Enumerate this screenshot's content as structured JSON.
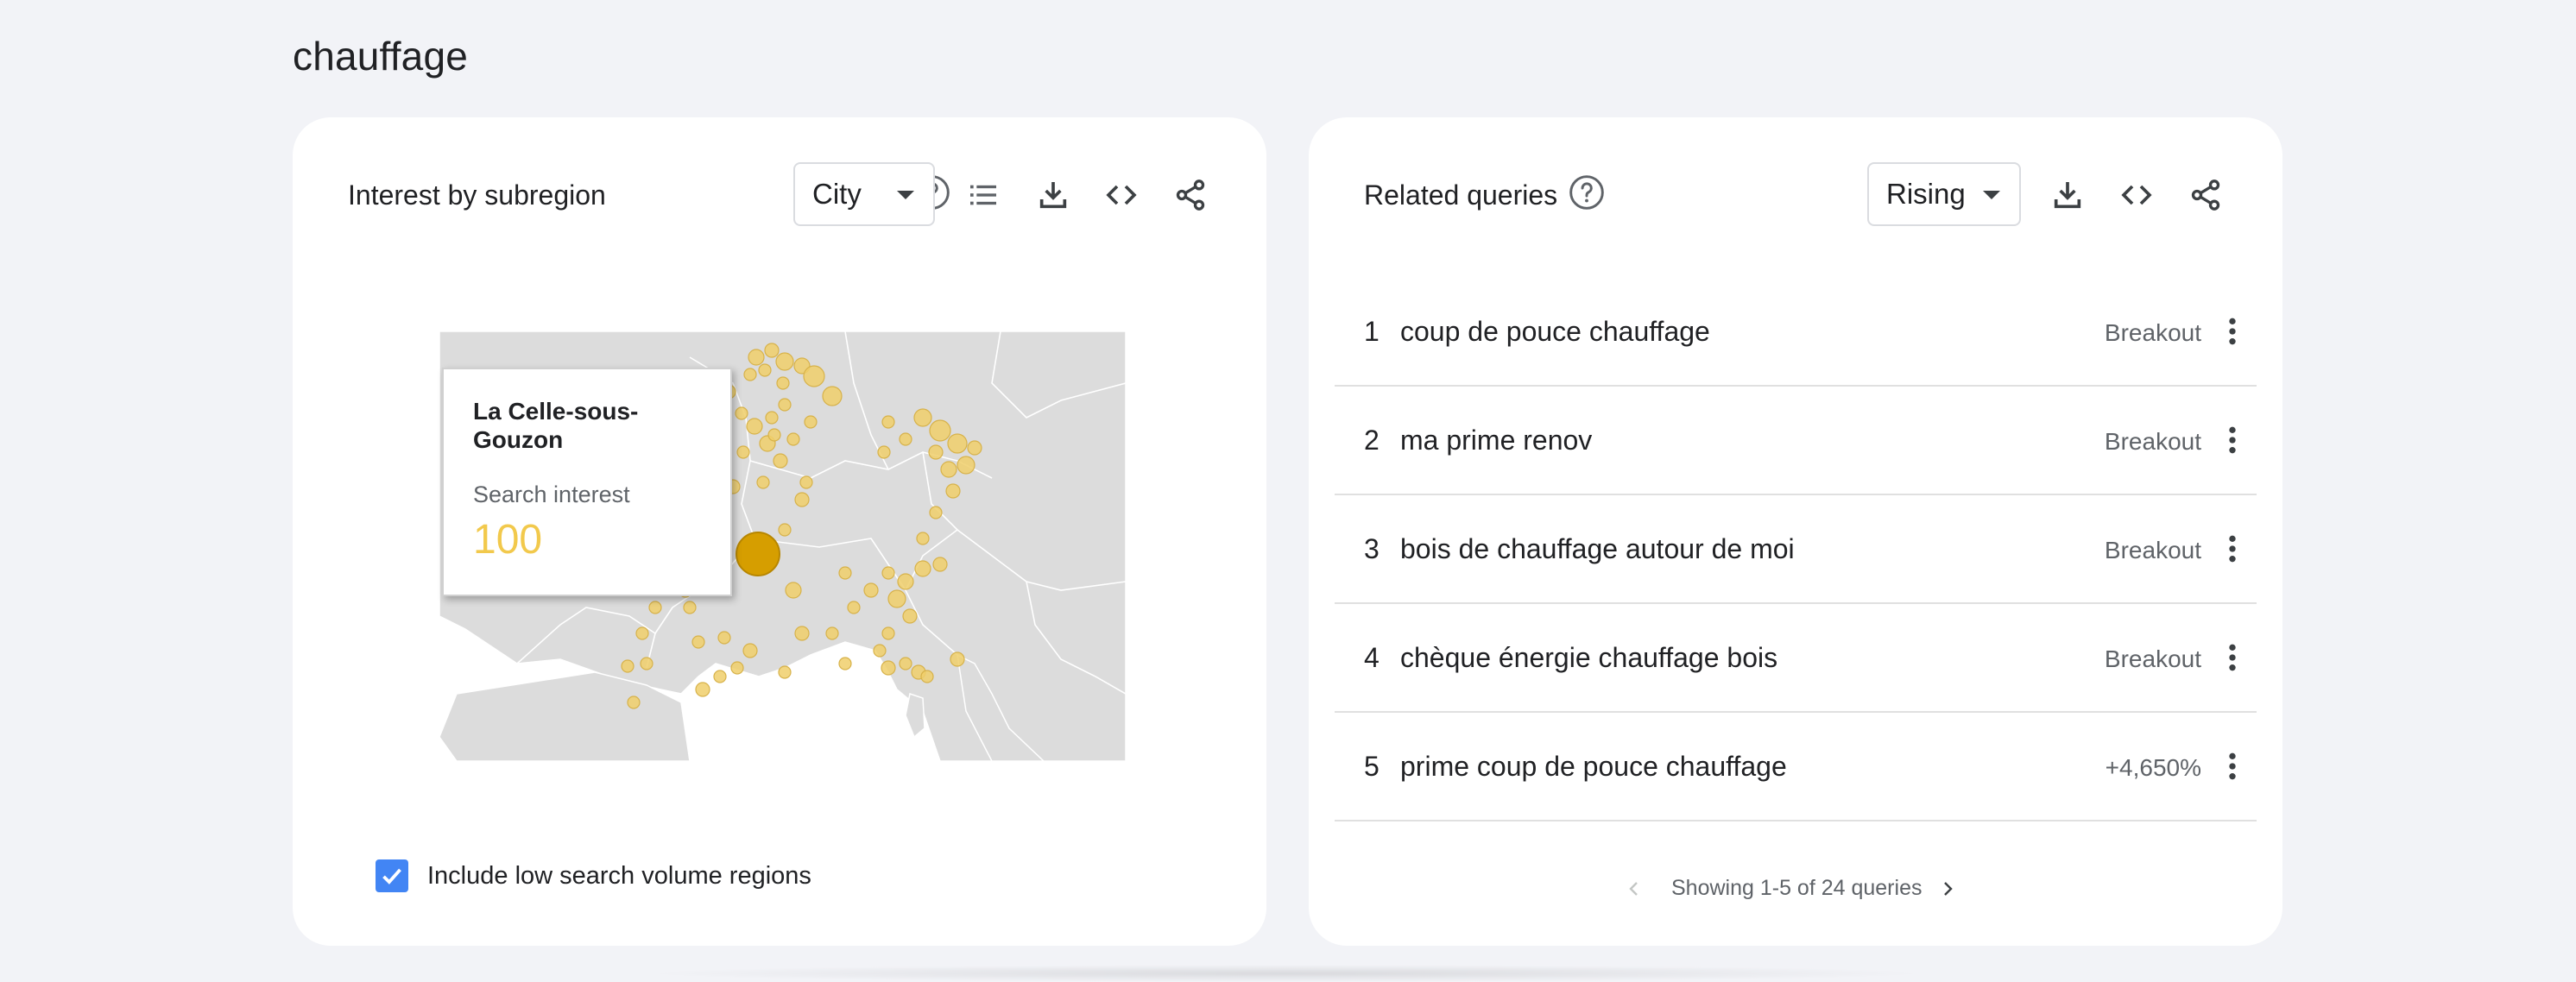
{
  "search_term": "chauffage",
  "subregion_card": {
    "title": "Interest by subregion",
    "resolution_dropdown": {
      "selected": "City"
    },
    "icons": [
      "help-icon",
      "list-icon",
      "download-icon",
      "embed-code-icon",
      "share-icon"
    ],
    "tooltip": {
      "place": "La Celle-sous-Gouzon",
      "label": "Search interest",
      "value": "100"
    },
    "checkbox": {
      "label": "Include low search volume regions",
      "checked": true
    },
    "colors": {
      "bubble": "#f0cf6b",
      "bubble_stroke": "#d7b24a",
      "highlight": "#d69e00",
      "land": "#dcdcdc",
      "border": "#ffffff",
      "water": "#ffffff",
      "checkbox": "#4285f4"
    }
  },
  "queries_card": {
    "title": "Related queries",
    "mode_dropdown": {
      "selected": "Rising"
    },
    "icons": [
      "help-icon",
      "download-icon",
      "embed-code-icon",
      "share-icon"
    ],
    "rows": [
      {
        "rank": "1",
        "query": "coup de pouce chauffage",
        "value": "Breakout"
      },
      {
        "rank": "2",
        "query": "ma prime renov",
        "value": "Breakout"
      },
      {
        "rank": "3",
        "query": "bois de chauffage autour de moi",
        "value": "Breakout"
      },
      {
        "rank": "4",
        "query": "chèque énergie chauffage bois",
        "value": "Breakout"
      },
      {
        "rank": "5",
        "query": "prime coup de pouce chauffage",
        "value": "+4,650%"
      }
    ],
    "pagination": {
      "text": "Showing 1-5 of 24 queries"
    }
  }
}
